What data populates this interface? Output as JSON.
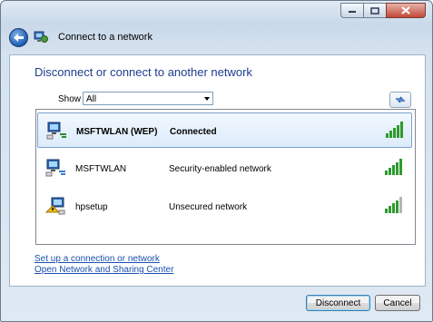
{
  "window": {
    "title": "Connect to a network",
    "controls": {
      "minimize": "minimize-icon",
      "maximize": "maximize-icon",
      "close": "close-icon"
    }
  },
  "main": {
    "heading": "Disconnect or connect to another network",
    "filter": {
      "label": "Show",
      "value": "All"
    }
  },
  "networks": [
    {
      "name": "MSFTWLAN (WEP)",
      "status": "Connected",
      "icon": "connected-network-icon",
      "selected": true,
      "signal_bars": 5
    },
    {
      "name": "MSFTWLAN",
      "status": "Security-enabled network",
      "icon": "wireless-network-icon",
      "selected": false,
      "signal_bars": 5
    },
    {
      "name": "hpsetup",
      "status": "Unsecured network",
      "icon": "unsecured-network-icon",
      "selected": false,
      "signal_bars": 4
    }
  ],
  "links": {
    "setup": "Set up a connection or network",
    "sharing_center": "Open Network and Sharing Center"
  },
  "buttons": {
    "disconnect": "Disconnect",
    "cancel": "Cancel"
  },
  "colors": {
    "heading": "#1e3c8c",
    "link": "#1a4fb0",
    "signal_on": "#2e9a2e",
    "signal_off": "#b5b5b5"
  }
}
